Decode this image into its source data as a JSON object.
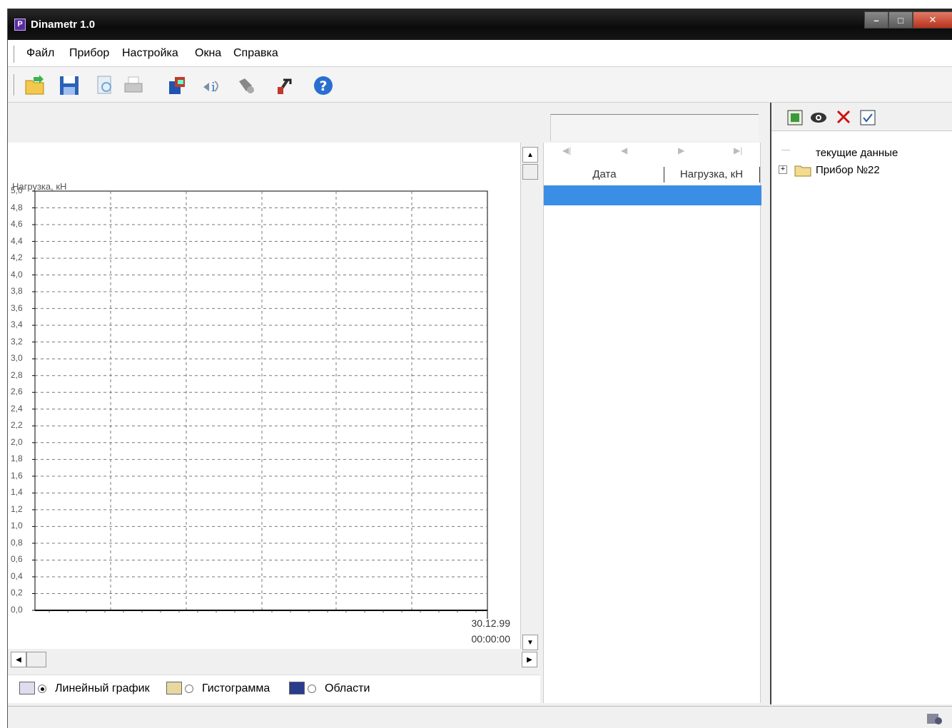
{
  "window": {
    "title": "Dinametr 1.0"
  },
  "menu": {
    "items": [
      "Файл",
      "Прибор",
      "Настройка",
      "Окна",
      "Справка"
    ]
  },
  "toolbar": {
    "icons": [
      "open-folder-icon",
      "save-icon",
      "print-preview-icon",
      "print-icon",
      "device-icon",
      "read-icon",
      "connect-icon",
      "settings-icon",
      "help-icon"
    ]
  },
  "chart": {
    "ylabel": "Нагрузка, кН",
    "yticks": [
      "5,0",
      "4,8",
      "4,6",
      "4,4",
      "4,2",
      "4,0",
      "3,8",
      "3,6",
      "3,4",
      "3,2",
      "3,0",
      "2,8",
      "2,6",
      "2,4",
      "2,2",
      "2,0",
      "1,8",
      "1,6",
      "1,4",
      "1,2",
      "1,0",
      "0,8",
      "0,6",
      "0,4",
      "0,2",
      "0,0"
    ],
    "x_date": "30.12.99",
    "x_time": "00:00:00"
  },
  "chart_data": {
    "type": "line",
    "ylabel": "Нагрузка, кН",
    "ylim": [
      0,
      5.0
    ],
    "x": [],
    "values": [],
    "grid": true
  },
  "chart_types": {
    "line": "Линейный график",
    "hist": "Гистограмма",
    "area": "Области",
    "selected": "line"
  },
  "table": {
    "columns": [
      "Дата",
      "Нагрузка, кН"
    ]
  },
  "tree": {
    "current": "текущие данные",
    "device": "Прибор №22"
  }
}
